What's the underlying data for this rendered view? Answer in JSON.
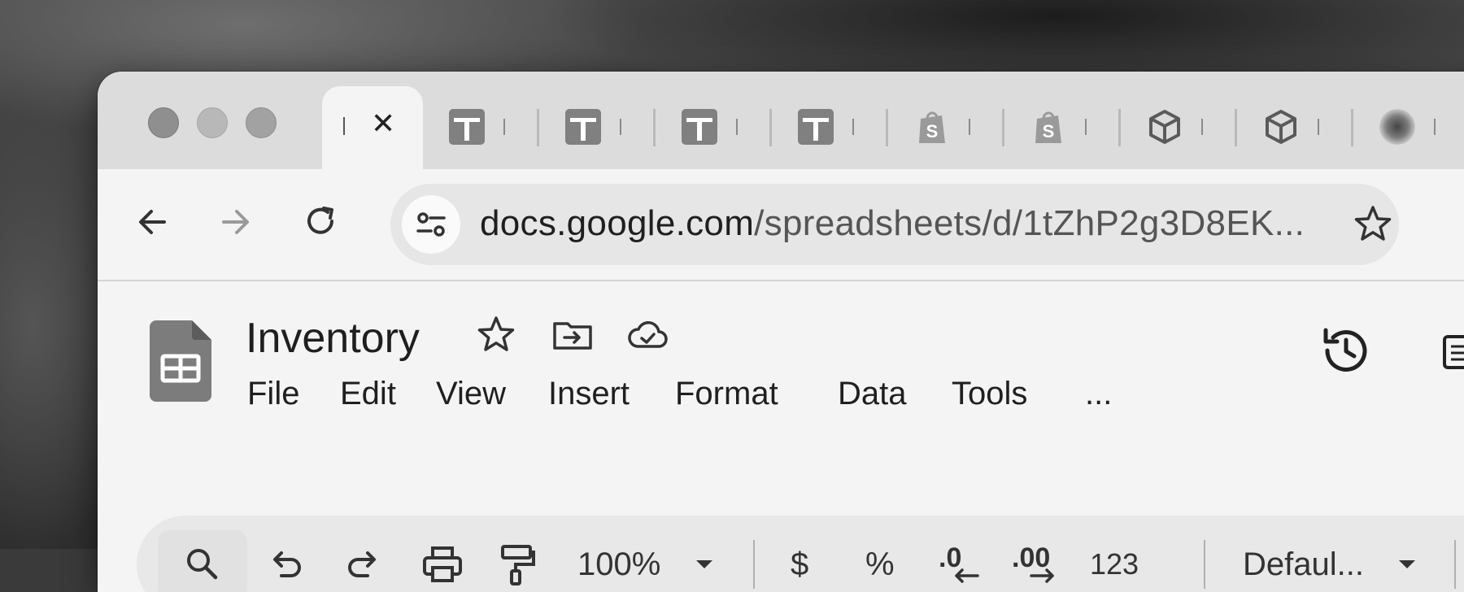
{
  "browser": {
    "tabs": [
      {
        "type": "sheets",
        "favicon": "sheets-plus-icon"
      },
      {
        "type": "sheets",
        "favicon": "sheets-plus-icon"
      },
      {
        "type": "sheets",
        "favicon": "sheets-plus-icon"
      },
      {
        "type": "sheets",
        "favicon": "sheets-plus-icon"
      },
      {
        "type": "shopify",
        "favicon": "shopify-bag-icon"
      },
      {
        "type": "shopify",
        "favicon": "shopify-bag-icon"
      },
      {
        "type": "box",
        "favicon": "box-icon"
      },
      {
        "type": "box",
        "favicon": "box-icon"
      },
      {
        "type": "profile",
        "favicon": "blurred-avatar-icon"
      }
    ],
    "active_tab_close": "✕",
    "url": {
      "domain": "docs.google.com",
      "path": "/spreadsheets/d/1tZhP2g3D8EK..."
    }
  },
  "doc": {
    "title": "Inventory"
  },
  "menu": {
    "file": "File",
    "edit": "Edit",
    "view": "View",
    "insert": "Insert",
    "format": "Format",
    "data": "Data",
    "tools": "Tools",
    "more": "..."
  },
  "format_toolbar": {
    "zoom": "100%",
    "currency": "$",
    "percent": "%",
    "decrease_decimal": ".0",
    "increase_decimal": ".00",
    "number_format": "123",
    "font": "Defaul..."
  },
  "colors": {
    "window_bg": "#f4f4f4",
    "tabstrip_bg": "#dcdcdc",
    "icon_gray": "#808080",
    "text_dark": "#1f1f1f"
  }
}
